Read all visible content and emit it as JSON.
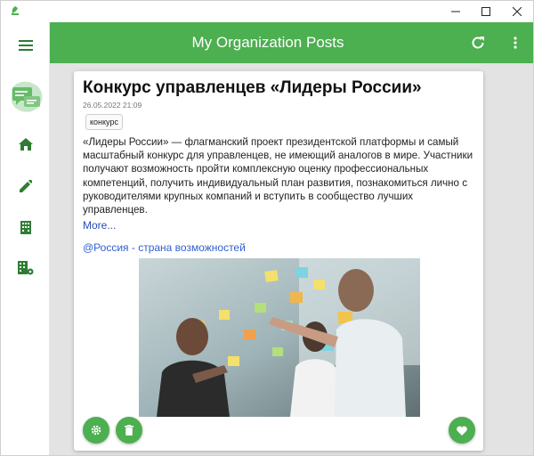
{
  "window": {
    "controls": [
      "minimize",
      "maximize",
      "close"
    ]
  },
  "colors": {
    "accent": "#4caf50",
    "background": "#e3e3e3",
    "link": "#2f5fd0"
  },
  "sidebar": {
    "items": [
      {
        "icon": "menu-icon"
      },
      {
        "icon": "app-logo"
      },
      {
        "icon": "home-icon"
      },
      {
        "icon": "pencil-icon"
      },
      {
        "icon": "building-icon"
      },
      {
        "icon": "building-settings-icon"
      }
    ]
  },
  "appbar": {
    "title": "My Organization Posts",
    "actions": [
      "refresh-icon",
      "more-vert-icon"
    ]
  },
  "post": {
    "title": "Конкурс управленцев «Лидеры России»",
    "date": "26.05.2022 21:09",
    "tag": "конкурс",
    "text": "«Лидеры России» — флагманский проект президентской платформы и самый масштабный конкурс для управленцев, не имеющий аналогов в мире. Участники получают возможность пройти комплексную оценку профессиональных компетенций, получить индивидуальный план развития, познакомиться лично с руководителями крупных компаний и вступить в сообщество лучших управленцев.",
    "more": "More...",
    "hashtag": "@Россия - страна возможностей",
    "image": "photo of people writing on a glass board with sticky notes"
  },
  "fabs": [
    "settings-icon",
    "delete-icon",
    "favorite-icon"
  ]
}
